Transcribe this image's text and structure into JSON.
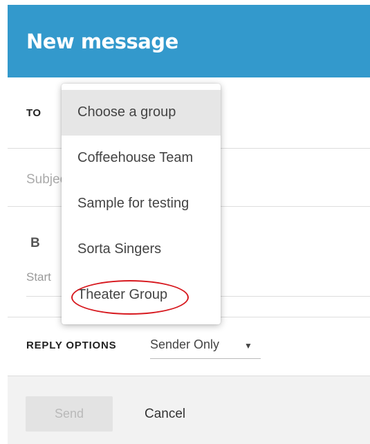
{
  "header": {
    "title": "New message"
  },
  "form": {
    "to_label": "TO",
    "subject_placeholder": "Subject",
    "bold_label": "B",
    "body_placeholder": "Start",
    "reply_options_label": "REPLY OPTIONS",
    "reply_options_value": "Sender Only"
  },
  "group_dropdown": {
    "items": [
      {
        "label": "Choose a group",
        "selected": true
      },
      {
        "label": "Coffeehouse Team"
      },
      {
        "label": "Sample for testing"
      },
      {
        "label": "Sorta Singers"
      },
      {
        "label": "Theater Group",
        "annotated": true
      }
    ]
  },
  "footer": {
    "send_label": "Send",
    "cancel_label": "Cancel"
  },
  "colors": {
    "header_bg": "#3399cc",
    "annotation_ring": "#d7191f"
  },
  "icons": {
    "select_arrow": "caret-down-icon"
  }
}
